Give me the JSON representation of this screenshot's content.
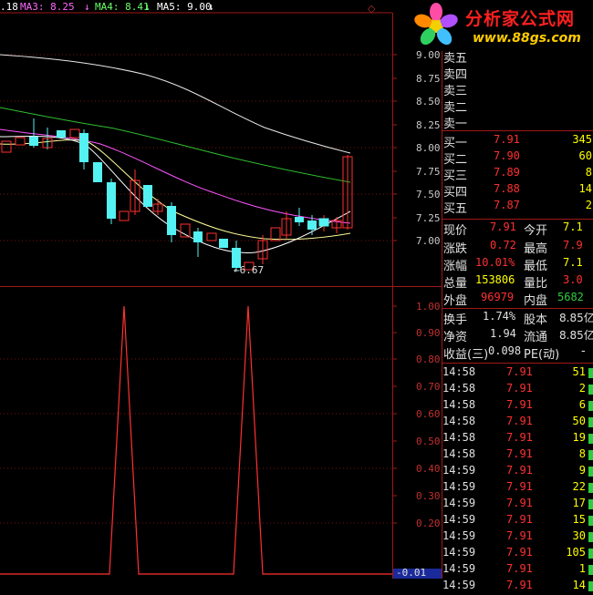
{
  "ma_legend": [
    {
      "label": ".18",
      "color": "#ffffff"
    },
    {
      "label": "MA3: 8.25",
      "color": "#ff66ff"
    },
    {
      "label": "MA4: 8.41",
      "color": "#66ff66"
    },
    {
      "label": "MA5: 9.00",
      "color": "#ffffff"
    }
  ],
  "logo": {
    "title": "分析家公式网",
    "url": "www.88gs.com"
  },
  "price_axis": [
    "9.00",
    "8.75",
    "8.50",
    "8.25",
    "8.00",
    "7.75",
    "7.50",
    "7.25",
    "7.00"
  ],
  "low_marker": "←6.67",
  "indicator_axis": [
    "1.00",
    "0.90",
    "0.80",
    "0.70",
    "0.60",
    "0.50",
    "0.40",
    "0.30",
    "0.20"
  ],
  "indicator_value": "-0.01",
  "sell_book": [
    {
      "label": "卖五"
    },
    {
      "label": "卖四"
    },
    {
      "label": "卖三"
    },
    {
      "label": "卖二"
    },
    {
      "label": "卖一"
    }
  ],
  "buy_book": [
    {
      "label": "买一",
      "price": "7.91",
      "vol": "345"
    },
    {
      "label": "买二",
      "price": "7.90",
      "vol": "60"
    },
    {
      "label": "买三",
      "price": "7.89",
      "vol": "8"
    },
    {
      "label": "买四",
      "price": "7.88",
      "vol": "14"
    },
    {
      "label": "买五",
      "price": "7.87",
      "vol": "2"
    }
  ],
  "stats": {
    "current_label": "现价",
    "current": "7.91",
    "open_label": "今开",
    "open": "7.1",
    "change_label": "涨跌",
    "change": "0.72",
    "high_label": "最高",
    "high": "7.9",
    "pct_label": "涨幅",
    "pct": "10.01%",
    "low_label": "最低",
    "low": "7.1",
    "volume_label": "总量",
    "volume": "153806",
    "ratio_label": "量比",
    "ratio": "3.0",
    "outer_label": "外盘",
    "outer": "96979",
    "inner_label": "内盘",
    "inner": "5682",
    "turnover_label": "换手",
    "turnover": "1.74%",
    "shares_label": "股本",
    "shares": "8.85亿",
    "netasset_label": "净资",
    "netasset": "1.94",
    "float_label": "流通",
    "float": "8.85亿",
    "eps_label": "收益(三)",
    "eps": "0.098",
    "pe_label": "PE(动)",
    "pe": "-"
  },
  "ticks": [
    {
      "time": "14:58",
      "price": "7.91",
      "vol": "51"
    },
    {
      "time": "14:58",
      "price": "7.91",
      "vol": "2"
    },
    {
      "time": "14:58",
      "price": "7.91",
      "vol": "6"
    },
    {
      "time": "14:58",
      "price": "7.91",
      "vol": "50"
    },
    {
      "time": "14:58",
      "price": "7.91",
      "vol": "19"
    },
    {
      "time": "14:58",
      "price": "7.91",
      "vol": "8"
    },
    {
      "time": "14:59",
      "price": "7.91",
      "vol": "9"
    },
    {
      "time": "14:59",
      "price": "7.91",
      "vol": "22"
    },
    {
      "time": "14:59",
      "price": "7.91",
      "vol": "17"
    },
    {
      "time": "14:59",
      "price": "7.91",
      "vol": "15"
    },
    {
      "time": "14:59",
      "price": "7.91",
      "vol": "30"
    },
    {
      "time": "14:59",
      "price": "7.91",
      "vol": "105"
    },
    {
      "time": "14:59",
      "price": "7.91",
      "vol": "1"
    },
    {
      "time": "14:59",
      "price": "7.91",
      "vol": "14"
    }
  ]
}
